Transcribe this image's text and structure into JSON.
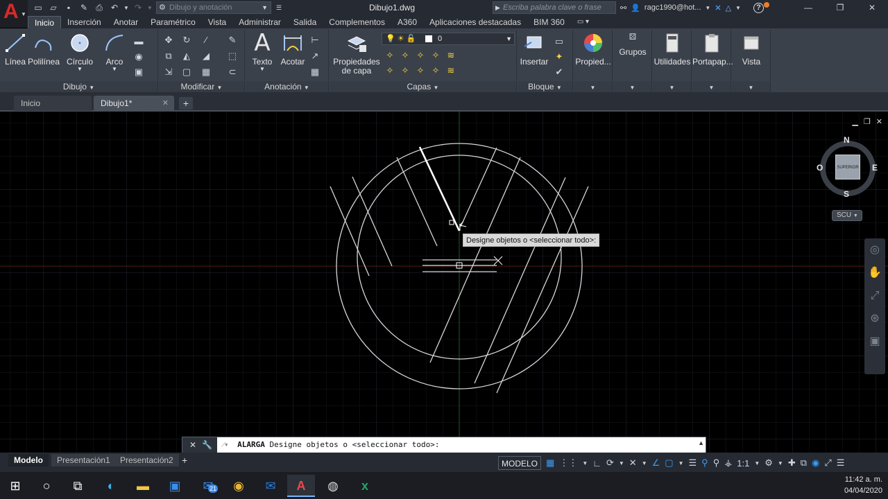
{
  "titlebar": {
    "workspace": "Dibujo y anotación",
    "document_title": "Dibujo1.dwg",
    "search_placeholder": "Escriba palabra clave o frase",
    "user": "ragc1990@hot..."
  },
  "ribbon_tabs": [
    "Inicio",
    "Inserción",
    "Anotar",
    "Paramétrico",
    "Vista",
    "Administrar",
    "Salida",
    "Complementos",
    "A360",
    "Aplicaciones destacadas",
    "BIM 360"
  ],
  "ribbon": {
    "draw": {
      "line": "Línea",
      "polyline": "Polilínea",
      "circle": "Círculo",
      "arc": "Arco",
      "panel": "Dibujo"
    },
    "modify": {
      "panel": "Modificar"
    },
    "annotation": {
      "text": "Texto",
      "dimension": "Acotar",
      "panel": "Anotación"
    },
    "layers": {
      "properties_line1": "Propiedades",
      "properties_line2": "de capa",
      "current_layer": "0",
      "panel": "Capas"
    },
    "block": {
      "insert": "Insertar",
      "panel": "Bloque"
    },
    "properties": "Propied...",
    "groups": "Grupos",
    "utilities": "Utilidades",
    "clipboard": "Portapap...",
    "view": "Vista"
  },
  "file_tabs": {
    "start": "Inicio",
    "drawing": "Dibujo1*"
  },
  "viewcube": {
    "north": "N",
    "south": "S",
    "east": "E",
    "west": "O",
    "face": "SUPERIOR",
    "ucs": "SCU"
  },
  "tooltip": "Designe objetos o <seleccionar todo>:",
  "command": {
    "name": "ALARGA",
    "prompt": "Designe objetos o <seleccionar todo>:"
  },
  "layout_tabs": [
    "Modelo",
    "Presentación1",
    "Presentación2"
  ],
  "status": {
    "model": "MODELO",
    "scale": "1:1"
  },
  "taskbar": {
    "outlook_badge": "21"
  },
  "clock": {
    "time": "11:42 a. m.",
    "date": "04/04/2020"
  }
}
